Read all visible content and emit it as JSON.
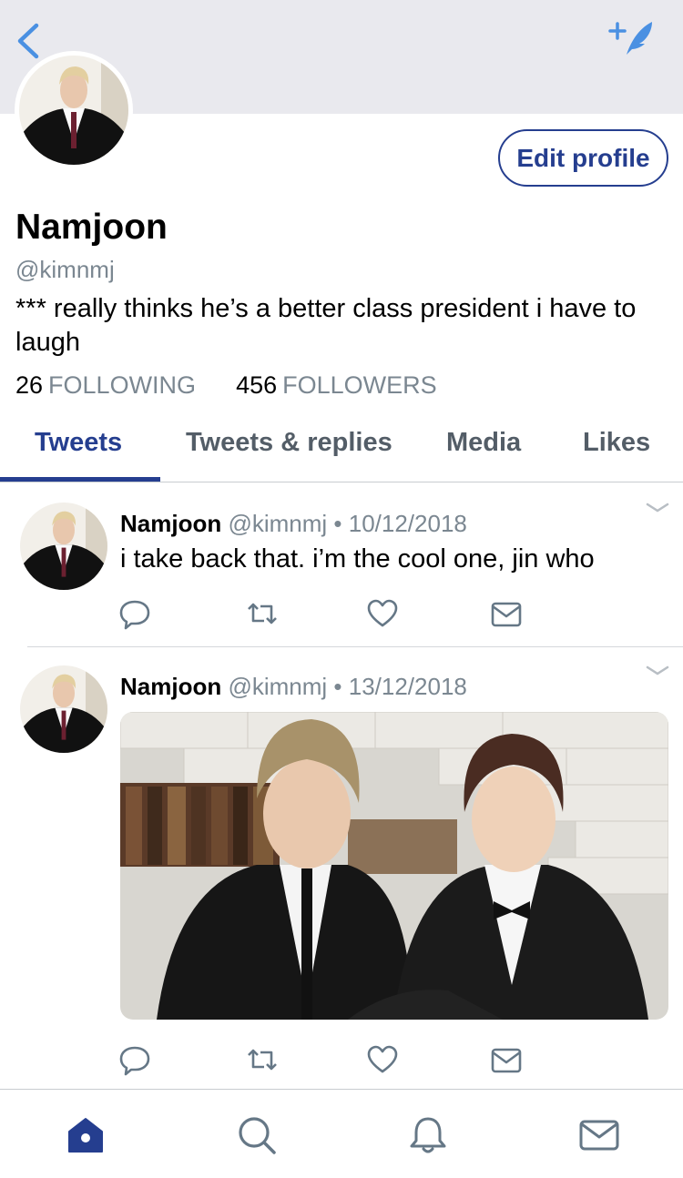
{
  "colors": {
    "accent": "#253e8f",
    "link_blue": "#4a90e2",
    "muted": "#7b8791",
    "header_bg": "#e9e9ee",
    "divider": "#d5d8dc"
  },
  "header": {
    "back_icon": "chevron-left-icon",
    "compose_icon": "compose-feather-icon"
  },
  "profile": {
    "edit_profile_label": "Edit profile",
    "name": "Namjoon",
    "handle": "@kimnmj",
    "bio": "*** really thinks he’s a better class president i have to laugh",
    "following_count": "26",
    "following_label": "FOLLOWING",
    "followers_count": "456",
    "followers_label": "FOLLOWERS"
  },
  "tabs": [
    {
      "label": "Tweets",
      "active": true
    },
    {
      "label": "Tweets & replies",
      "active": false
    },
    {
      "label": "Media",
      "active": false
    },
    {
      "label": "Likes",
      "active": false
    }
  ],
  "tweets": [
    {
      "name": "Namjoon",
      "meta": "@kimnmj • 10/12/2018",
      "text": "i take back that. i’m the cool one, jin who"
    },
    {
      "name": "Namjoon",
      "meta": "@kimnmj • 13/12/2018",
      "text": ""
    }
  ],
  "action_icons": [
    "reply-icon",
    "retweet-icon",
    "like-heart-icon",
    "direct-message-icon"
  ],
  "bottom_bar": [
    {
      "icon": "home-icon",
      "active": true
    },
    {
      "icon": "search-icon",
      "active": false
    },
    {
      "icon": "notifications-bell-icon",
      "active": false
    },
    {
      "icon": "messages-envelope-icon",
      "active": false
    }
  ]
}
